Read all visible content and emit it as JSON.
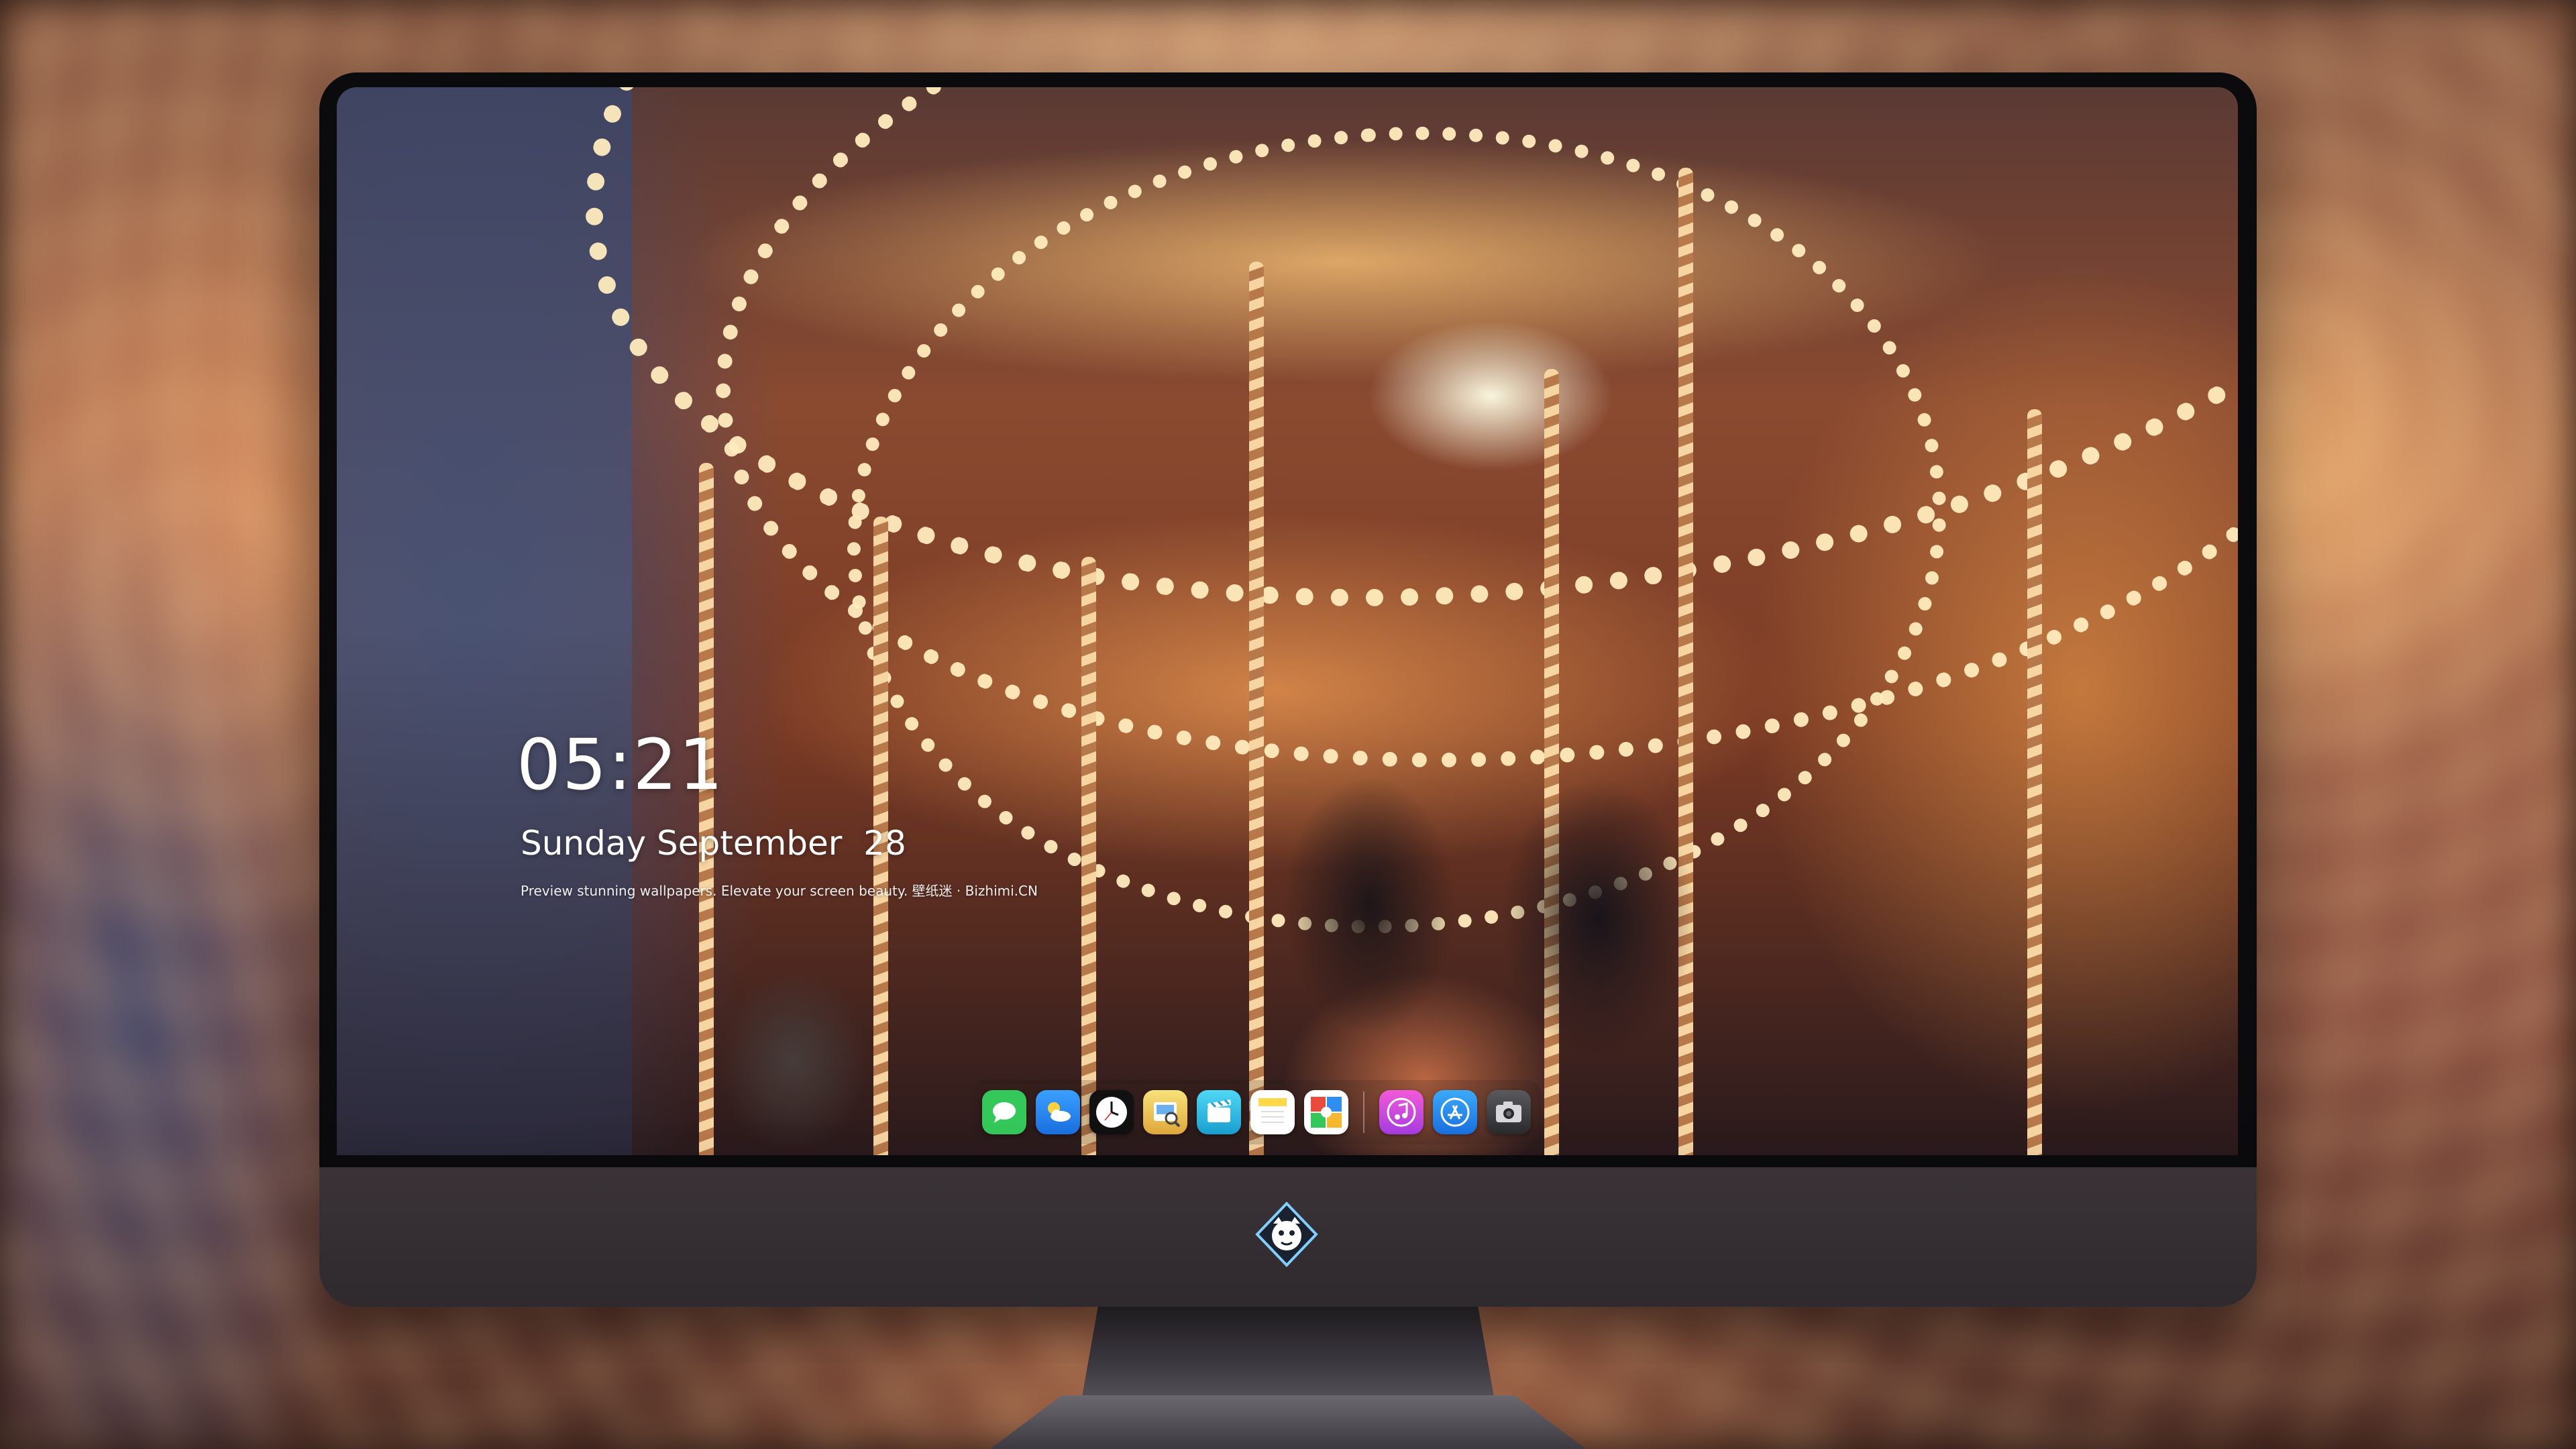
{
  "lock_screen": {
    "time": "05:21",
    "date": "Sunday September  28",
    "caption": "Preview stunning wallpapers. Elevate your screen beauty. 壁纸迷 · Bizhimi.CN"
  },
  "dock": {
    "apps": [
      {
        "name": "Messages",
        "icon": "messages-icon",
        "color": "#34c759"
      },
      {
        "name": "Weather",
        "icon": "weather-icon",
        "color": "#2f8ff0"
      },
      {
        "name": "Clock",
        "icon": "clock-icon",
        "color": "#111111"
      },
      {
        "name": "Preview",
        "icon": "preview-icon",
        "color": "#f0c040"
      },
      {
        "name": "Clips",
        "icon": "clips-icon",
        "color": "#2ec4e6"
      },
      {
        "name": "Notes",
        "icon": "notes-icon",
        "color": "#ffd84a"
      },
      {
        "name": "Photo Booth",
        "icon": "photo-booth-icon",
        "color": "#e84a3c"
      },
      {
        "name": "iTunes",
        "icon": "itunes-icon",
        "color": "#e84cc8"
      },
      {
        "name": "App Store",
        "icon": "app-store-icon",
        "color": "#1e8cf0"
      },
      {
        "name": "Camera",
        "icon": "camera-icon",
        "color": "#3a3a3c"
      }
    ]
  },
  "colors": {
    "bezel": "#0b0b0d",
    "chin": "#3a3236",
    "accent_light": "#ffecbe"
  }
}
